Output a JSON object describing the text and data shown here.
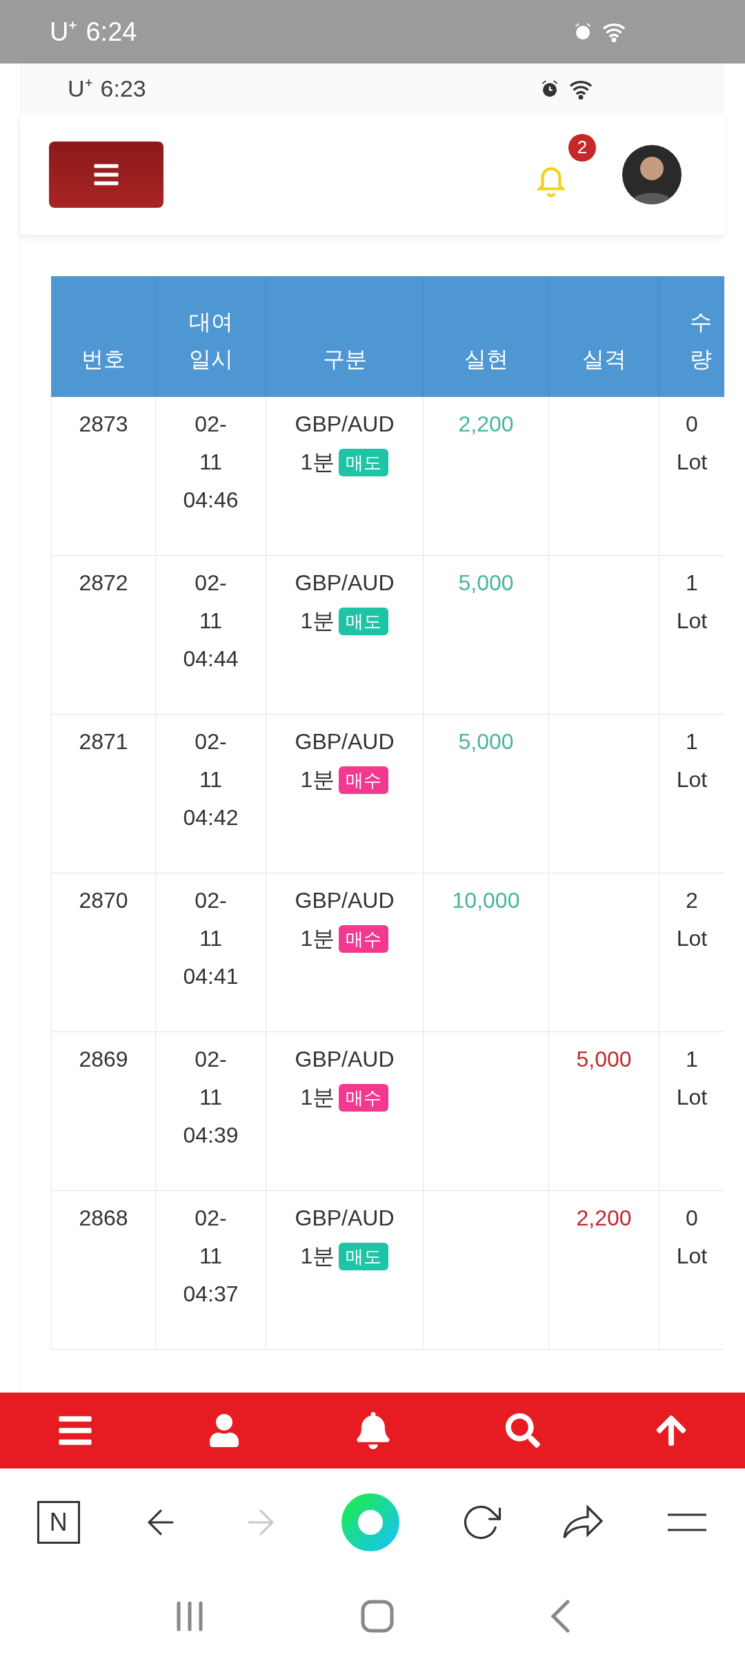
{
  "status_bar": {
    "carrier": "U⁺",
    "time": "6:24"
  },
  "inner_status_bar": {
    "carrier": "U⁺",
    "time": "6:23"
  },
  "header": {
    "notification_count": "2"
  },
  "table": {
    "columns": [
      {
        "lines": [
          "번호"
        ]
      },
      {
        "lines": [
          "대여",
          "일시"
        ]
      },
      {
        "lines": [
          "구분"
        ]
      },
      {
        "lines": [
          "실현"
        ]
      },
      {
        "lines": [
          "실격"
        ]
      },
      {
        "lines": [
          "수",
          "량"
        ]
      }
    ],
    "rows": [
      {
        "number": "2873",
        "date_lines": [
          "02-",
          "11",
          "04:46"
        ],
        "pair": "GBP/AUD",
        "period": "1분",
        "side": {
          "kind": "sell",
          "label": "매도"
        },
        "profit": "2,200",
        "loss": "",
        "quantity": "0 Lot"
      },
      {
        "number": "2872",
        "date_lines": [
          "02-",
          "11",
          "04:44"
        ],
        "pair": "GBP/AUD",
        "period": "1분",
        "side": {
          "kind": "sell",
          "label": "매도"
        },
        "profit": "5,000",
        "loss": "",
        "quantity": "1 Lot"
      },
      {
        "number": "2871",
        "date_lines": [
          "02-",
          "11",
          "04:42"
        ],
        "pair": "GBP/AUD",
        "period": "1분",
        "side": {
          "kind": "buy",
          "label": "매수"
        },
        "profit": "5,000",
        "loss": "",
        "quantity": "1 Lot"
      },
      {
        "number": "2870",
        "date_lines": [
          "02-",
          "11",
          "04:41"
        ],
        "pair": "GBP/AUD",
        "period": "1분",
        "side": {
          "kind": "buy",
          "label": "매수"
        },
        "profit": "10,000",
        "loss": "",
        "quantity": "2 Lot"
      },
      {
        "number": "2869",
        "date_lines": [
          "02-",
          "11",
          "04:39"
        ],
        "pair": "GBP/AUD",
        "period": "1분",
        "side": {
          "kind": "buy",
          "label": "매수"
        },
        "profit": "",
        "loss": "5,000",
        "quantity": "1 Lot"
      },
      {
        "number": "2868",
        "date_lines": [
          "02-",
          "11",
          "04:37"
        ],
        "pair": "GBP/AUD",
        "period": "1분",
        "side": {
          "kind": "sell",
          "label": "매도"
        },
        "profit": "",
        "loss": "2,200",
        "quantity": "0 Lot"
      }
    ]
  },
  "browser_toolbar": {
    "tabs_label": "N"
  }
}
